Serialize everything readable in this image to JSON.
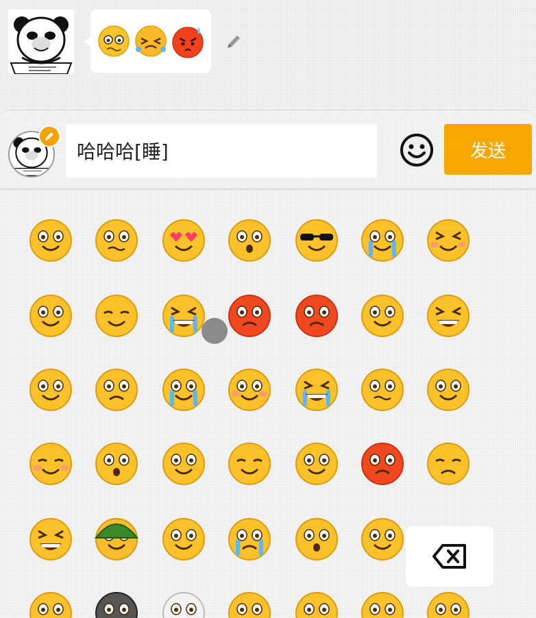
{
  "chat": {
    "message_emojis": [
      "woozy-face-emoji",
      "crying-laugh-squint-emoji",
      "angry-red-sweat-emoji"
    ]
  },
  "composer": {
    "input_value": "哈哈哈[睡]",
    "send_label": "发送",
    "accent_color": "#f7a800"
  },
  "emoji_panel": {
    "rows": [
      [
        "smile",
        "woozy",
        "heart-eyes",
        "surprised-frown",
        "sunglasses",
        "crying-tears",
        "squint-blush"
      ],
      [
        "hand-over-mouth",
        "sleepy-zzz",
        "crying-laugh-squint",
        "angry-red-sweat",
        "furious-red",
        "wink-tongue",
        "big-grin"
      ],
      [
        "peeking-mouth-cover",
        "frown",
        "tears-of-joy",
        "pleading",
        "laughing-tears",
        "nauseated",
        "facepalm"
      ],
      [
        "blush-smile",
        "eyes-up",
        "confused",
        "pensive",
        "eye-roll",
        "scared-red",
        "unamused"
      ],
      [
        "grinning",
        "army-helmet",
        "thinking-hand",
        "crying-angry",
        "question",
        "shush",
        "blank"
      ],
      [
        "flushed-partial",
        "cat-partial",
        "ghost-partial",
        "ninja-partial",
        "dizzy-partial",
        "relieved-partial",
        "tired-partial"
      ]
    ],
    "backspace_icon": "backspace-icon"
  }
}
